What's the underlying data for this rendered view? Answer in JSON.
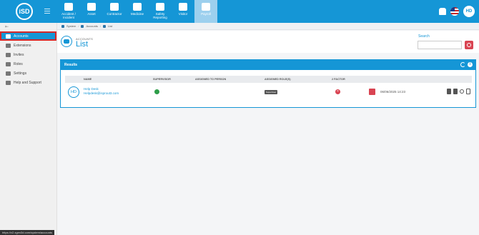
{
  "nav": {
    "logo_text": "iSD",
    "items": [
      {
        "label": "Accident / Incident",
        "icon": "accident-icon"
      },
      {
        "label": "Asset",
        "icon": "asset-icon"
      },
      {
        "label": "Contractor",
        "icon": "contractor-icon"
      },
      {
        "label": "Medicine",
        "icon": "medicine-icon"
      },
      {
        "label": "Safety Reporting",
        "icon": "safety-reporting-icon"
      },
      {
        "label": "Visitor",
        "icon": "visitor-icon"
      },
      {
        "label": "Payroll",
        "icon": "payroll-icon"
      }
    ],
    "avatar_initials": "HD"
  },
  "breadcrumb": [
    "System",
    "Accounts",
    "List"
  ],
  "sidebar": {
    "items": [
      {
        "label": "Accounts",
        "icon": "users-icon"
      },
      {
        "label": "Extensions",
        "icon": "puzzle-icon"
      },
      {
        "label": "Invites",
        "icon": "envelope-icon"
      },
      {
        "label": "Roles",
        "icon": "roles-icon"
      },
      {
        "label": "Settings",
        "icon": "gears-icon"
      },
      {
        "label": "Help and Support",
        "icon": "help-icon"
      }
    ],
    "status_url": "https://v2.xgen3d.com/system/accounts"
  },
  "header": {
    "subtitle": "ACCOUNTS",
    "title": "List",
    "search_label": "Search",
    "search_value": ""
  },
  "results": {
    "title": "Results",
    "columns": {
      "name": "NAME",
      "supervisor": "SUPERVISOR",
      "assigned_person": "ASSIGNED TO PERSON",
      "assigned_roles": "ASSIGNED ROLE(S)",
      "two_factor": "2 FACTOR"
    },
    "rows": [
      {
        "initials": "HD",
        "name": "Help Desk",
        "email": "Helpdesk@isprout3.com",
        "role": "SuperUser",
        "date": "06/06/2025 14:23"
      }
    ]
  }
}
